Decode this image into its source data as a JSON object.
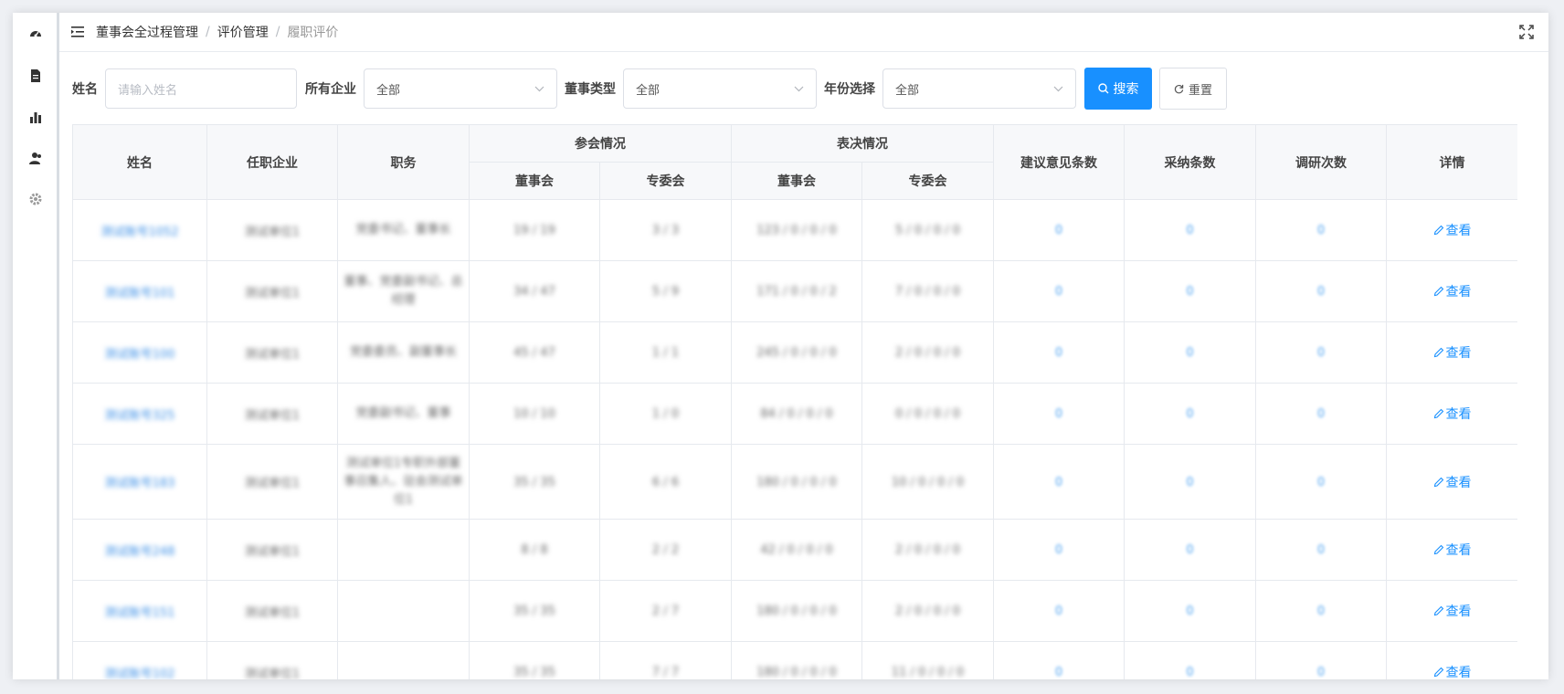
{
  "breadcrumb": [
    "董事会全过程管理",
    "评价管理",
    "履职评价"
  ],
  "filters": {
    "name_label": "姓名",
    "name_placeholder": "请输入姓名",
    "company_label": "所有企业",
    "company_value": "全部",
    "director_type_label": "董事类型",
    "director_type_value": "全部",
    "year_label": "年份选择",
    "year_value": "全部",
    "search_label": "搜索",
    "reset_label": "重置"
  },
  "table": {
    "headers": {
      "name": "姓名",
      "company": "任职企业",
      "position": "职务",
      "attendance": "参会情况",
      "voting": "表决情况",
      "suggestions": "建议意见条数",
      "adopted": "采纳条数",
      "research": "调研次数",
      "details": "详情",
      "board": "董事会",
      "committee": "专委会",
      "board2": "董事会",
      "committee2": "专委会"
    },
    "rows": [
      {
        "name": "测试账号1052",
        "company": "测试单位1",
        "position": "党委书记、董事长",
        "att_board": "19 / 19",
        "att_comm": "3 / 3",
        "vote_board": "123 / 0 / 0 / 0",
        "vote_comm": "5 / 0 / 0 / 0",
        "suggestions": "0",
        "adopted": "0",
        "research": "0",
        "action": "查看"
      },
      {
        "name": "测试账号101",
        "company": "测试单位1",
        "position": "董事、党委副书记、总经理",
        "att_board": "34 / 47",
        "att_comm": "5 / 9",
        "vote_board": "171 / 0 / 0 / 2",
        "vote_comm": "7 / 0 / 0 / 0",
        "suggestions": "0",
        "adopted": "0",
        "research": "0",
        "action": "查看"
      },
      {
        "name": "测试账号100",
        "company": "测试单位1",
        "position": "党委委员、副董事长",
        "att_board": "45 / 47",
        "att_comm": "1 / 1",
        "vote_board": "245 / 0 / 0 / 0",
        "vote_comm": "2 / 0 / 0 / 0",
        "suggestions": "0",
        "adopted": "0",
        "research": "0",
        "action": "查看"
      },
      {
        "name": "测试账号325",
        "company": "测试单位1",
        "position": "党委副书记、董事",
        "att_board": "10 / 10",
        "att_comm": "1 / 0",
        "vote_board": "84 / 0 / 0 / 0",
        "vote_comm": "0 / 0 / 0 / 0",
        "suggestions": "0",
        "adopted": "0",
        "research": "0",
        "action": "查看"
      },
      {
        "name": "测试账号183",
        "company": "测试单位1",
        "position": "测试单位1专职外部董事召集人、驻会测试单位1",
        "att_board": "35 / 35",
        "att_comm": "6 / 6",
        "vote_board": "180 / 0 / 0 / 0",
        "vote_comm": "10 / 0 / 0 / 0",
        "suggestions": "0",
        "adopted": "0",
        "research": "0",
        "action": "查看"
      },
      {
        "name": "测试账号248",
        "company": "测试单位1",
        "position": "",
        "att_board": "8 / 8",
        "att_comm": "2 / 2",
        "vote_board": "42 / 0 / 0 / 0",
        "vote_comm": "2 / 0 / 0 / 0",
        "suggestions": "0",
        "adopted": "0",
        "research": "0",
        "action": "查看"
      },
      {
        "name": "测试账号151",
        "company": "测试单位1",
        "position": "",
        "att_board": "35 / 35",
        "att_comm": "2 / 7",
        "vote_board": "180 / 0 / 0 / 0",
        "vote_comm": "2 / 0 / 0 / 0",
        "suggestions": "0",
        "adopted": "0",
        "research": "0",
        "action": "查看"
      },
      {
        "name": "测试账号102",
        "company": "测试单位1",
        "position": "",
        "att_board": "35 / 35",
        "att_comm": "7 / 7",
        "vote_board": "180 / 0 / 0 / 0",
        "vote_comm": "11 / 0 / 0 / 0",
        "suggestions": "0",
        "adopted": "0",
        "research": "0",
        "action": "查看"
      }
    ]
  }
}
